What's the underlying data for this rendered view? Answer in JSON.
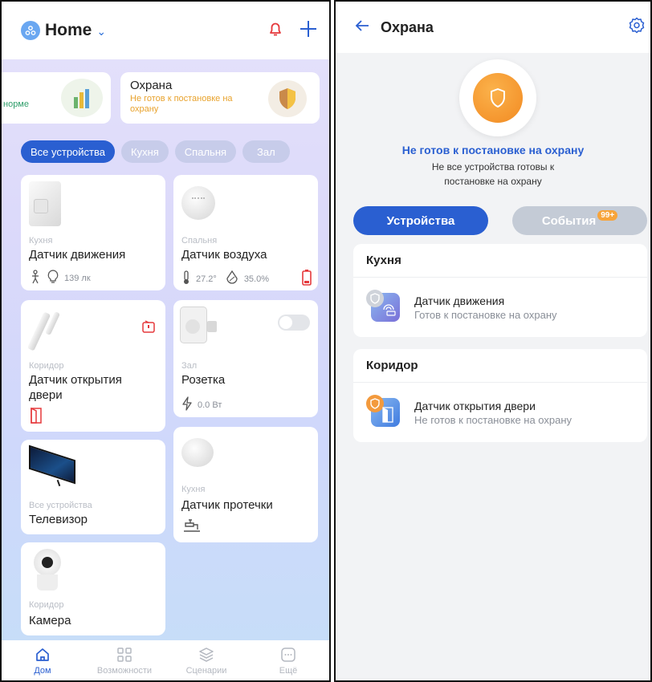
{
  "home": {
    "title": "Home",
    "security_card": {
      "title": "Охрана",
      "status": "Не готов к постановке на охрану"
    },
    "partial_card_text": "норме",
    "filters": [
      "Все устройства",
      "Кухня",
      "Спальня",
      "Зал"
    ],
    "devices": [
      {
        "room": "Кухня",
        "name": "Датчик движения",
        "lux": "139 лк"
      },
      {
        "room": "Спальня",
        "name": "Датчик воздуха",
        "temp": "27.2°",
        "humidity": "35.0%"
      },
      {
        "room": "Коридор",
        "name": "Датчик открытия двери"
      },
      {
        "room": "Зал",
        "name": "Розетка",
        "power": "0.0 Вт"
      },
      {
        "room": "Все устройства",
        "name": "Телевизор"
      },
      {
        "room": "Кухня",
        "name": "Датчик протечки"
      },
      {
        "room": "Коридор",
        "name": "Камера"
      }
    ],
    "tabs": [
      "Дом",
      "Возможности",
      "Сценарии",
      "Ещё"
    ]
  },
  "security": {
    "title": "Охрана",
    "status_title": "Не готов к постановке на охрану",
    "status_sub": "Не все устройства готовы к постановке на охрану",
    "tab_devices": "Устройства",
    "tab_events": "События",
    "events_badge": "99+",
    "groups": [
      {
        "name": "Кухня",
        "device": "Датчик движения",
        "state": "Готов к постановке на охрану"
      },
      {
        "name": "Коридор",
        "device": "Датчик открытия двери",
        "state": "Не готов к постановке на охрану"
      }
    ]
  },
  "colors": {
    "accent": "#2a5fd1",
    "warning": "#f7a43a",
    "alert": "#e5383b"
  }
}
